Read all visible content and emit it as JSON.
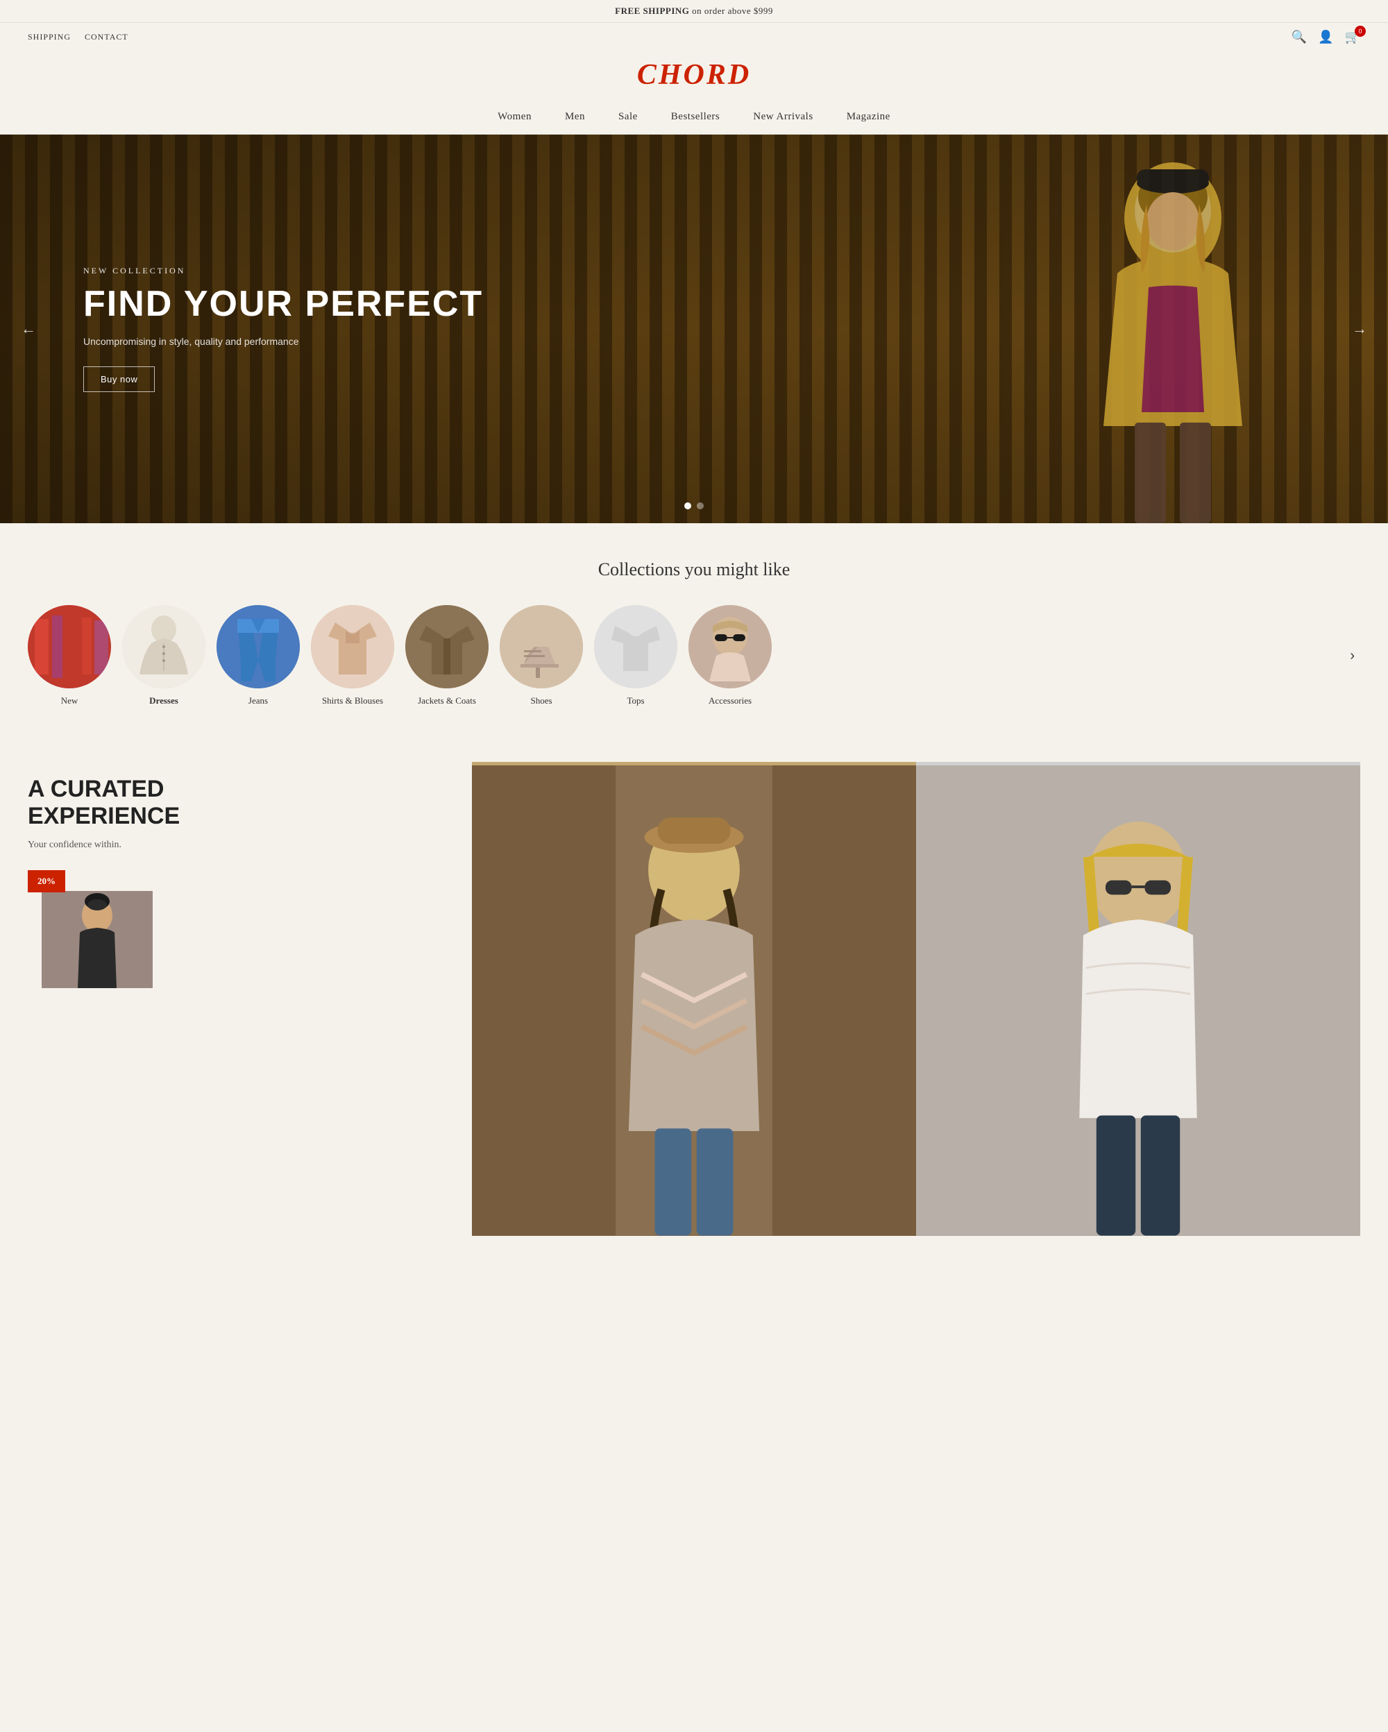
{
  "announcement": {
    "prefix": "FREE SHIPPING",
    "suffix": "on order above $999"
  },
  "utility_nav": {
    "links": [
      {
        "label": "SHIPPING",
        "href": "#"
      },
      {
        "label": "CONTACT",
        "href": "#"
      }
    ],
    "cart_count": "0"
  },
  "logo": {
    "text": "CHORD"
  },
  "main_nav": {
    "items": [
      {
        "label": "Women"
      },
      {
        "label": "Men"
      },
      {
        "label": "Sale"
      },
      {
        "label": "Bestsellers"
      },
      {
        "label": "New Arrivals"
      },
      {
        "label": "Magazine"
      }
    ]
  },
  "hero": {
    "label": "NEW COLLECTION",
    "title": "FIND YOUR PERFECT",
    "subtitle": "Uncompromising in style, quality and performance",
    "cta": "Buy now",
    "dot1_active": true,
    "dot2_active": false
  },
  "collections": {
    "title": "Collections you might like",
    "items": [
      {
        "label": "New",
        "style": "cc-new",
        "bold": false
      },
      {
        "label": "Dresses",
        "style": "cc-dresses",
        "bold": true
      },
      {
        "label": "Jeans",
        "style": "cc-jeans",
        "bold": false
      },
      {
        "label": "Shirts & Blouses",
        "style": "cc-shirts",
        "bold": false
      },
      {
        "label": "Jackets & Coats",
        "style": "cc-jackets",
        "bold": false
      },
      {
        "label": "Shoes",
        "style": "cc-shoes",
        "bold": false
      },
      {
        "label": "Tops",
        "style": "cc-tops",
        "bold": false
      },
      {
        "label": "Accessories",
        "style": "cc-accessories",
        "bold": false
      }
    ]
  },
  "curated": {
    "heading_line1": "A CURATED",
    "heading_line2": "EXPERIENCE",
    "subtitle": "Your confidence within.",
    "badge_text": "20%"
  }
}
